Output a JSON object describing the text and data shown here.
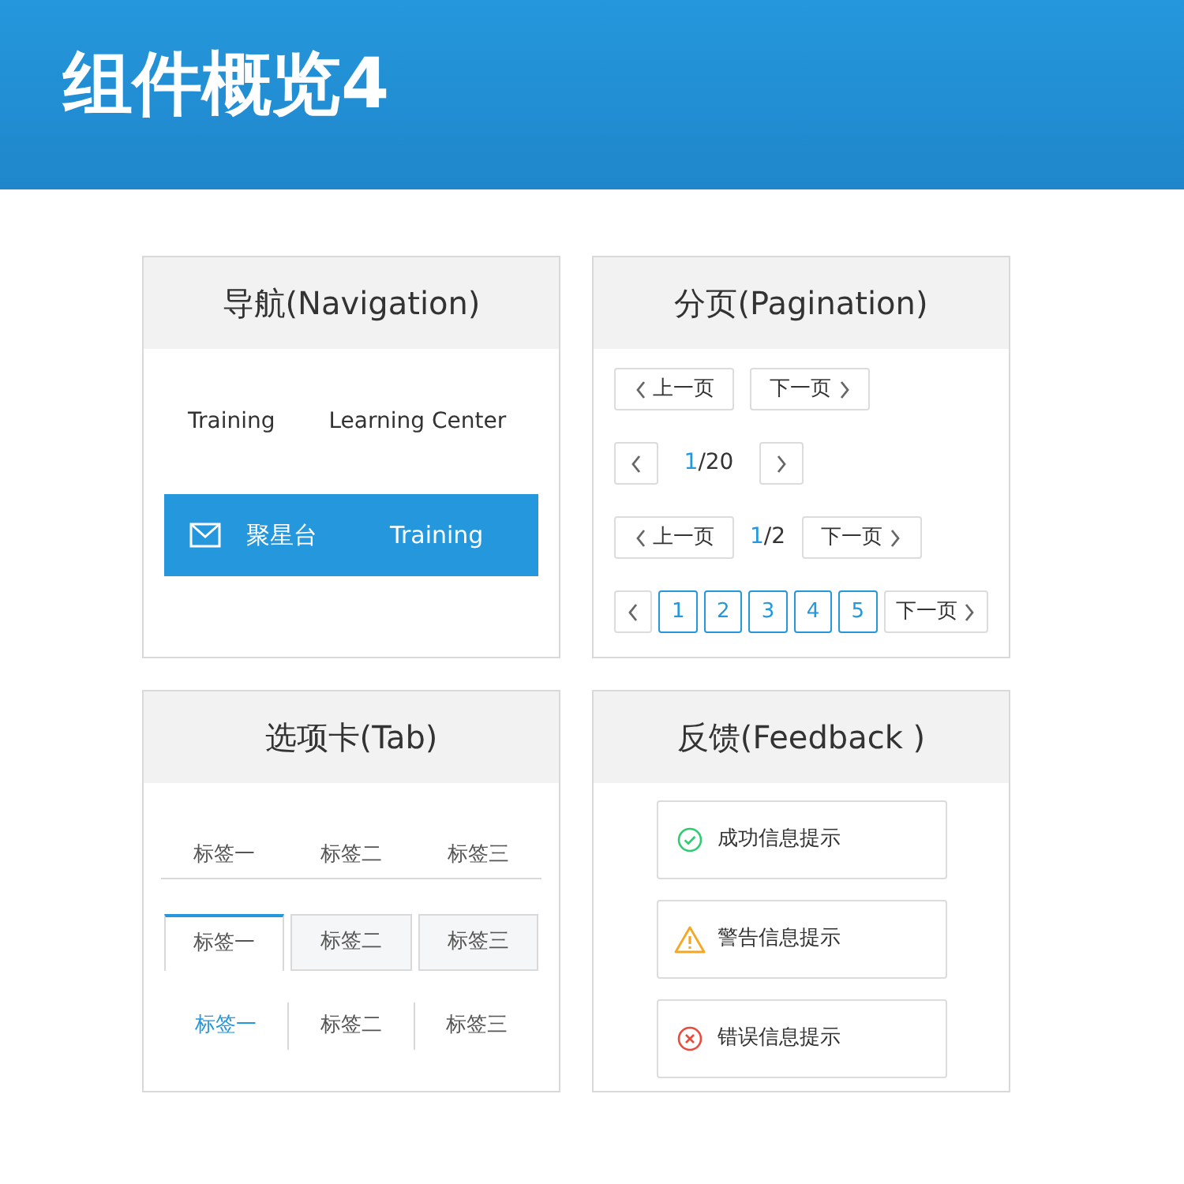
{
  "header": {
    "title": "组件概览4"
  },
  "navigation": {
    "title": "导航(Navigation)",
    "links": [
      "Training",
      "Learning Center"
    ],
    "bar": [
      {
        "label": "聚星台",
        "icon": true
      },
      {
        "label": "Training",
        "icon": false
      }
    ]
  },
  "pagination": {
    "title": "分页(Pagination)",
    "prev": "上一页",
    "next": "下一页",
    "simple": {
      "current": "1",
      "total": "/20"
    },
    "compact": {
      "prev": "上一页",
      "current": "1",
      "total": "/2",
      "next": "下一页"
    },
    "pages": [
      {
        "label": "1",
        "selected": false
      },
      {
        "label": "2",
        "selected": false
      },
      {
        "label": "3",
        "selected": false
      },
      {
        "label": "4",
        "selected": false
      },
      {
        "label": "5",
        "selected": false
      }
    ],
    "pages_next": "下一页"
  },
  "tabs": {
    "title": "选项卡(Tab)",
    "groups": [
      {
        "kind": "line",
        "tabs": [
          {
            "label": "标签一",
            "selected": false
          },
          {
            "label": "标签二",
            "selected": false
          },
          {
            "label": "标签三",
            "selected": false
          }
        ]
      },
      {
        "kind": "card",
        "tabs": [
          {
            "label": "标签一",
            "selected": true
          },
          {
            "label": "标签二",
            "selected": false
          },
          {
            "label": "标签三",
            "selected": false
          }
        ]
      },
      {
        "kind": "text",
        "tabs": [
          {
            "label": "标签一",
            "selected": true
          },
          {
            "label": "标签二",
            "selected": false
          },
          {
            "label": "标签三",
            "selected": false
          }
        ]
      }
    ]
  },
  "feedback": {
    "title": "反馈(Feedback )",
    "messages": [
      {
        "kind": "success",
        "text": "成功信息提示"
      },
      {
        "kind": "warning",
        "text": "警告信息提示"
      },
      {
        "kind": "error",
        "text": "错误信息提示"
      }
    ]
  }
}
